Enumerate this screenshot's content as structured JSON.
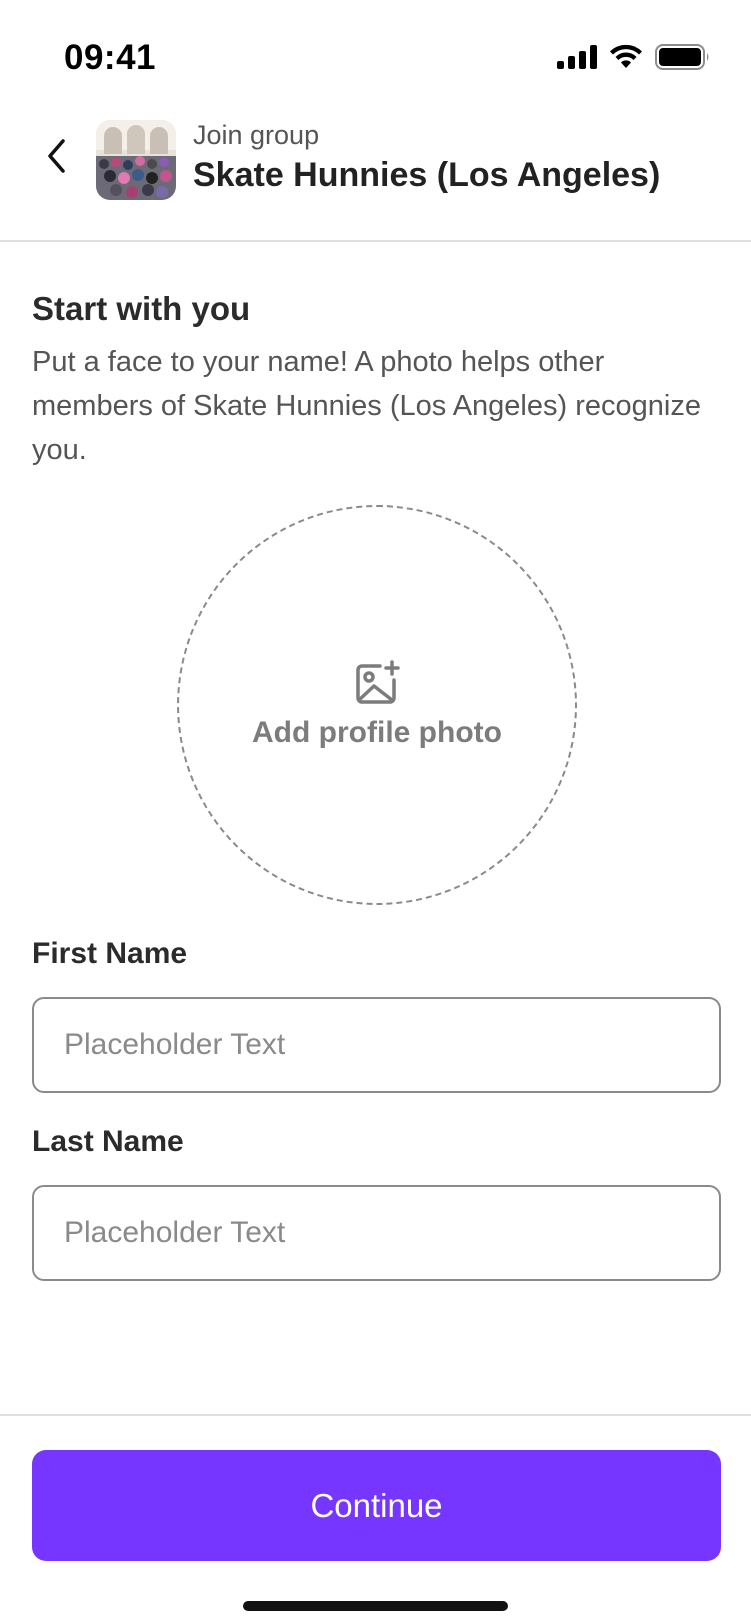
{
  "status_bar": {
    "time": "09:41",
    "icons": [
      "signal-icon",
      "wifi-icon",
      "battery-icon"
    ]
  },
  "header": {
    "back_icon": "chevron-left-icon",
    "subtitle": "Join group",
    "title": "Skate Hunnies (Los Angeles)"
  },
  "intro": {
    "title": "Start with you",
    "description": "Put a face to your name! A photo helps other members of Skate Hunnies (Los Angeles) recognize you."
  },
  "photo_picker": {
    "icon": "add-image-icon",
    "label": "Add profile photo"
  },
  "form": {
    "first_name": {
      "label": "First Name",
      "value": "",
      "placeholder": "Placeholder Text"
    },
    "last_name": {
      "label": "Last Name",
      "value": "",
      "placeholder": "Placeholder Text"
    }
  },
  "footer": {
    "continue_label": "Continue"
  },
  "colors": {
    "accent": "#7636ff",
    "text_primary": "#222222",
    "text_secondary": "#555555",
    "border": "#8a8a8a",
    "divider": "#dedede"
  }
}
